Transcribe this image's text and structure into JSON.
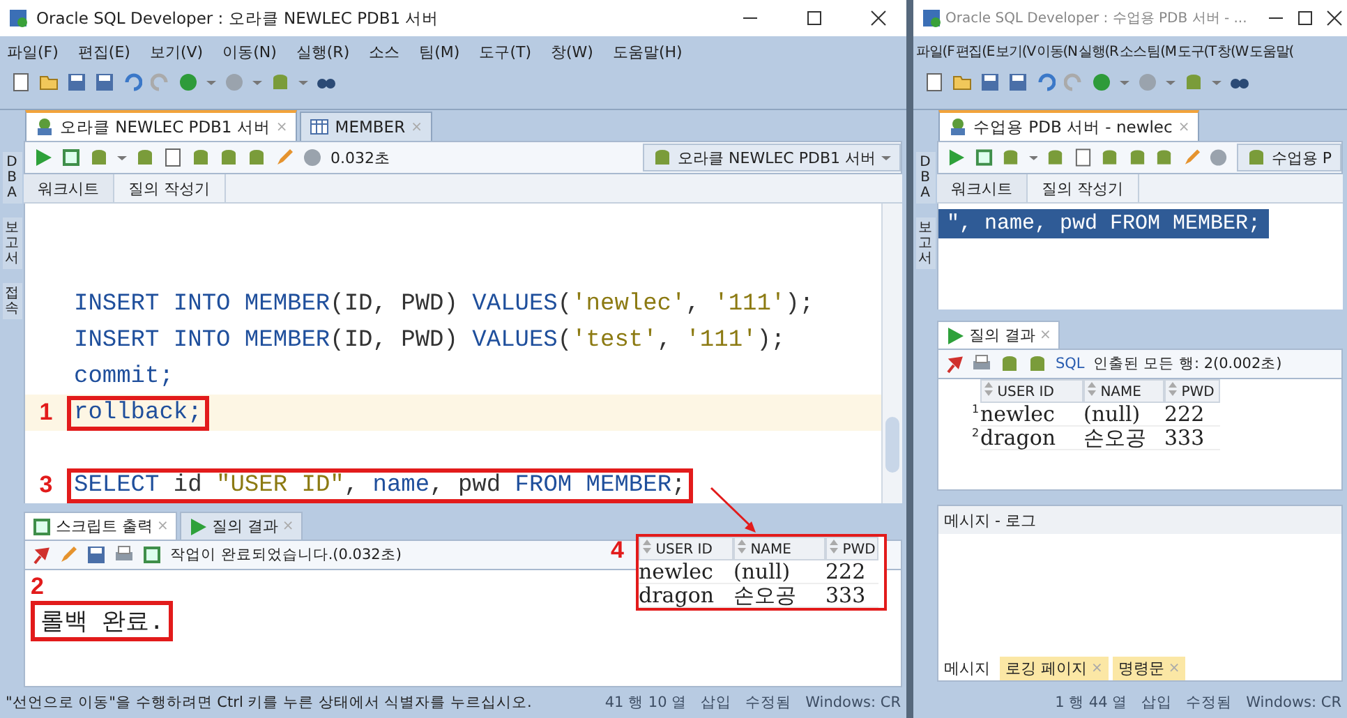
{
  "left_window": {
    "title": "Oracle SQL Developer : 오라클 NEWLEC PDB1 서버",
    "menu": [
      "파일(F)",
      "편집(E)",
      "보기(V)",
      "이동(N)",
      "실행(R)",
      "소스",
      "팀(M)",
      "도구(T)",
      "창(W)",
      "도움말(H)"
    ],
    "side_tabs": [
      "DBA",
      "보고서",
      "접속"
    ],
    "doc_tabs": [
      {
        "label": "오라클 NEWLEC PDB1 서버",
        "kind": "connection",
        "selected": true,
        "close": "×"
      },
      {
        "label": "MEMBER",
        "kind": "table",
        "selected": false,
        "close": "×"
      }
    ],
    "elapsed": "0.032초",
    "connection": "오라클 NEWLEC PDB1 서버",
    "sub_tabs": [
      {
        "label": "워크시트",
        "selected": true
      },
      {
        "label": "질의 작성기",
        "selected": false
      }
    ],
    "code_lines": [
      {
        "current": false,
        "tokens": [
          {
            "kind": "keyword",
            "text": "INSERT INTO MEMBER"
          },
          {
            "kind": "plain",
            "text": "(ID, PWD) "
          },
          {
            "kind": "keyword",
            "text": "VALUES"
          },
          {
            "kind": "plain",
            "text": "("
          },
          {
            "kind": "string",
            "text": "'newlec'"
          },
          {
            "kind": "plain",
            "text": ", "
          },
          {
            "kind": "string",
            "text": "'111'"
          },
          {
            "kind": "plain",
            "text": ");"
          }
        ]
      },
      {
        "current": false,
        "tokens": [
          {
            "kind": "keyword",
            "text": "INSERT INTO MEMBER"
          },
          {
            "kind": "plain",
            "text": "(ID, PWD) "
          },
          {
            "kind": "keyword",
            "text": "VALUES"
          },
          {
            "kind": "plain",
            "text": "("
          },
          {
            "kind": "string",
            "text": "'test'"
          },
          {
            "kind": "plain",
            "text": ", "
          },
          {
            "kind": "string",
            "text": "'111'"
          },
          {
            "kind": "plain",
            "text": ");"
          }
        ]
      },
      {
        "current": false,
        "tokens": [
          {
            "kind": "keyword",
            "text": "commit;"
          }
        ]
      },
      {
        "current": true,
        "marker": "1",
        "tokens": [
          {
            "kind": "keyword",
            "text": "rollback;"
          }
        ]
      },
      {
        "current": false
      },
      {
        "current": false,
        "marker": "3",
        "tokens": [
          {
            "kind": "keyword",
            "text": "SELECT"
          },
          {
            "kind": "plain",
            "text": " id "
          },
          {
            "kind": "string",
            "text": "\"USER ID\""
          },
          {
            "kind": "plain",
            "text": ", "
          },
          {
            "kind": "keyword",
            "text": "name"
          },
          {
            "kind": "plain",
            "text": ", pwd "
          },
          {
            "kind": "keyword",
            "text": "FROM MEMBER"
          },
          {
            "kind": "plain",
            "text": ";"
          }
        ]
      }
    ],
    "output_panel": {
      "tabs": [
        {
          "label": "스크립트 출력",
          "kind": "script",
          "selected": true,
          "close": "×"
        },
        {
          "label": "질의 결과",
          "kind": "query",
          "selected": false,
          "close": "×"
        }
      ],
      "status": "작업이 완료되었습니다.(0.032초)",
      "output": {
        "text": "롤백 완료.",
        "marker": "2"
      }
    },
    "status_bar": {
      "message": "\"선언으로 이동\"을 수행하려면 Ctrl 키를 누른 상태에서 식별자를 누르십시오.",
      "position": "41 행 10 열",
      "mode": "삽입",
      "modified": "수정됨",
      "line_ending": "Windows: CR"
    }
  },
  "right_window": {
    "title": "Oracle SQL Developer : 수업용 PDB 서버 - ...",
    "menu": [
      "파일(F",
      "편집(E",
      "보기(V",
      "이동(N",
      "실행(R",
      "소스",
      "팀(M",
      "도구(T",
      "창(W",
      "도움말("
    ],
    "side_tabs": [
      "DBA",
      "보고서"
    ],
    "doc_tabs": [
      {
        "label": "수업용 PDB 서버 - newlec",
        "kind": "connection",
        "selected": true,
        "close": "×"
      }
    ],
    "connection": "수업용 P",
    "sub_tabs": [
      {
        "label": "워크시트",
        "selected": true
      },
      {
        "label": "질의 작성기",
        "selected": false
      }
    ],
    "editor_line": {
      "text": "\", name, pwd FROM MEMBER;",
      "selected": true
    },
    "result_panel": {
      "tabs": [
        {
          "label": "질의 결과",
          "kind": "query",
          "selected": true,
          "close": "×"
        }
      ],
      "sql_link": "SQL",
      "status": "인출된 모든 행: 2(0.002초)",
      "columns": [
        "USER ID",
        "NAME",
        "PWD"
      ],
      "rows": [
        {
          "number": "1",
          "cells": [
            "newlec",
            "(null)",
            "222"
          ]
        },
        {
          "number": "2",
          "cells": [
            "dragon",
            "손오공",
            "333"
          ]
        }
      ]
    },
    "message_panel": {
      "title": "메시지 - 로그",
      "tabs": [
        {
          "label": "메시지",
          "selected": true
        },
        {
          "label": "로깅 페이지",
          "selected": false,
          "close": "×"
        },
        {
          "label": "명령문",
          "selected": false,
          "close": "×"
        }
      ]
    },
    "status_bar": {
      "position": "1 행 44 열",
      "mode": "삽입",
      "modified": "수정됨",
      "line_ending": "Windows: CR"
    }
  },
  "callout": {
    "marker": "4",
    "columns": [
      "USER ID",
      "NAME",
      "PWD"
    ],
    "rows": [
      [
        "newlec",
        "(null)",
        "222"
      ],
      [
        "dragon",
        "손오공",
        "333"
      ]
    ]
  }
}
